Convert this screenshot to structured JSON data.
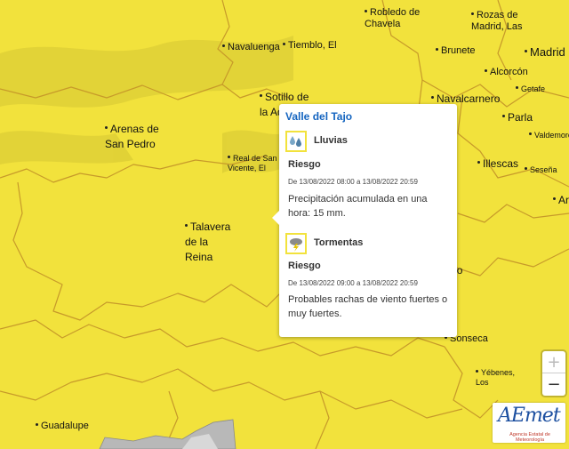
{
  "places": [
    {
      "id": "robledo",
      "lines": [
        "Robledo de",
        "Chavela"
      ],
      "dot": true
    },
    {
      "id": "rozas",
      "lines": [
        "Rozas de",
        "Madrid, Las"
      ],
      "dot": true
    },
    {
      "id": "navaluenga",
      "lines": [
        "Navaluenga"
      ],
      "dot": true
    },
    {
      "id": "tiemblo",
      "lines": [
        "Tiemblo, El"
      ],
      "dot": true
    },
    {
      "id": "brunete",
      "lines": [
        "Brunete"
      ],
      "dot": true
    },
    {
      "id": "madrid",
      "lines": [
        "Madrid"
      ],
      "dot": true
    },
    {
      "id": "alcorcon",
      "lines": [
        "Alcorcón"
      ],
      "dot": true
    },
    {
      "id": "getafe",
      "lines": [
        "Getafe"
      ],
      "dot": true
    },
    {
      "id": "sotillo",
      "lines": [
        "Sotillo de",
        "la Adrada"
      ],
      "dot": true
    },
    {
      "id": "navalcarnero",
      "lines": [
        "Navalcarnero"
      ],
      "dot": true
    },
    {
      "id": "parla",
      "lines": [
        "Parla"
      ],
      "dot": true
    },
    {
      "id": "arenas",
      "lines": [
        "Arenas de",
        "San Pedro"
      ],
      "dot": true
    },
    {
      "id": "valdemoro",
      "lines": [
        "Valdemoro"
      ],
      "dot": true
    },
    {
      "id": "real",
      "lines": [
        "Real de San",
        "Vicente, El"
      ],
      "dot": true
    },
    {
      "id": "illescas",
      "lines": [
        "Illescas"
      ],
      "dot": true
    },
    {
      "id": "sesena",
      "lines": [
        "Seseña"
      ],
      "dot": true
    },
    {
      "id": "aranjuez",
      "lines": [
        "Ara"
      ],
      "dot": true
    },
    {
      "id": "talavera",
      "lines": [
        "Talavera",
        "de la",
        "Reina"
      ],
      "dot": true
    },
    {
      "id": "toledo",
      "lines": [
        "Toledo"
      ],
      "dot": false
    },
    {
      "id": "sonseca",
      "lines": [
        "Sonseca"
      ],
      "dot": true
    },
    {
      "id": "yebenes",
      "lines": [
        "Yébenes,",
        "Los"
      ],
      "dot": true
    },
    {
      "id": "guadalupe",
      "lines": [
        "Guadalupe"
      ],
      "dot": true
    }
  ],
  "popup": {
    "zone": "Valle del Tajo",
    "warnings": [
      {
        "icon": "rain-icon",
        "name": "Lluvias",
        "riesgo": "Riesgo",
        "period": "De 13/08/2022 08:00 a 13/08/2022 20:59",
        "desc": "Precipitación acumulada en una hora: 15 mm."
      },
      {
        "icon": "storm-icon",
        "name": "Tormentas",
        "riesgo": "Riesgo",
        "period": "De 13/08/2022 09:00 a 13/08/2022 20:59",
        "desc": "Probables rachas de viento fuertes o muy fuertes."
      }
    ]
  },
  "zoom": {
    "in": "+",
    "out": "−"
  },
  "logo": {
    "word": "AEmet",
    "sub": "Agencia Estatal de Meteorología"
  },
  "colors": {
    "warning_yellow": "#f2e23c",
    "border": "#c79a2a",
    "popup_title": "#1565c0"
  }
}
